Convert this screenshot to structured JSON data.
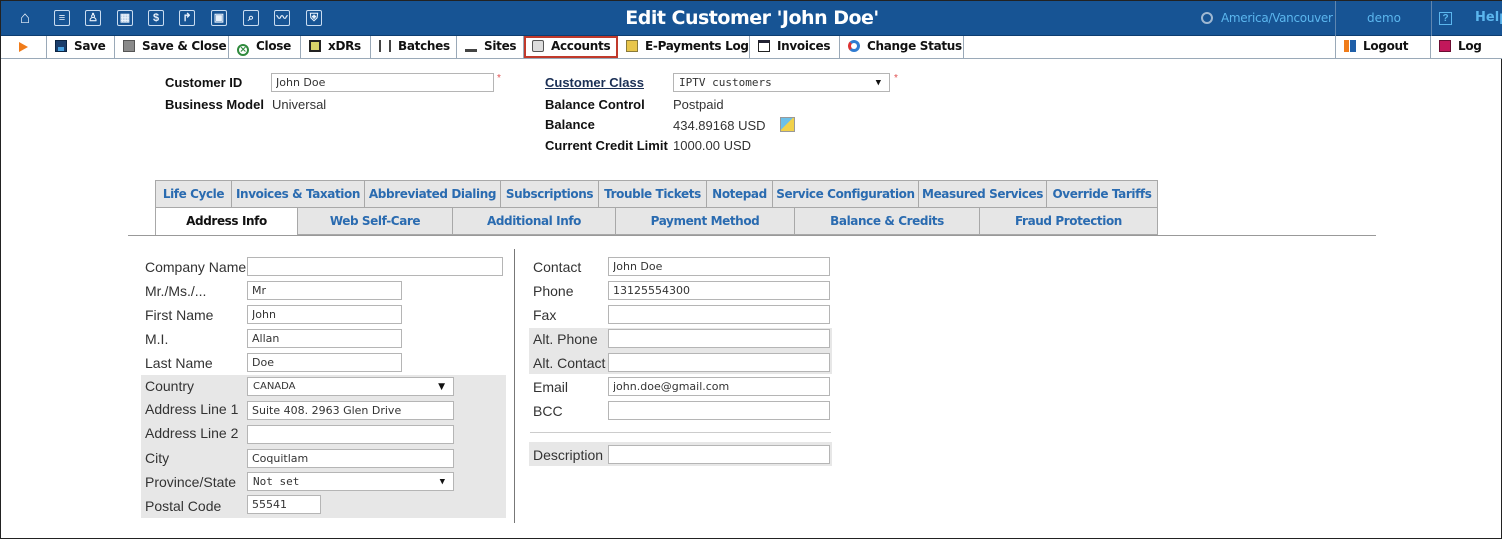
{
  "topbar": {
    "nav_icons": [
      "home-icon",
      "list-icon",
      "person-icon",
      "modules-icon",
      "dollar-icon",
      "routing-icon",
      "network-icon",
      "search-icon",
      "chart-icon",
      "shield-icon"
    ],
    "nav_glyphs": [
      "⌂",
      "≡",
      "♙",
      "▦",
      "$",
      "↱",
      "▣",
      "⌕",
      "〰",
      "⛨"
    ],
    "title": "Edit Customer 'John Doe'",
    "timezone": "America/Vancouver",
    "user": "demo",
    "help_label": "Help",
    "help_glyph": "?"
  },
  "toolbar": {
    "buttons": [
      {
        "label": "Save",
        "icon": "save-icon"
      },
      {
        "label": "Save & Close",
        "icon": "save-close-icon"
      },
      {
        "label": "Close",
        "icon": "close-icon"
      },
      {
        "label": "xDRs",
        "icon": "xdrs-icon"
      },
      {
        "label": "Batches",
        "icon": "batches-icon"
      },
      {
        "label": "Sites",
        "icon": "sites-icon"
      },
      {
        "label": "Accounts",
        "icon": "accounts-icon"
      },
      {
        "label": "E-Payments Log",
        "icon": "epayments-icon"
      },
      {
        "label": "Invoices",
        "icon": "invoices-icon"
      },
      {
        "label": "Change Status",
        "icon": "change-status-icon"
      }
    ],
    "active": "Accounts",
    "logout_label": "Logout",
    "log_label": "Log"
  },
  "header": {
    "customer_id_label": "Customer ID",
    "customer_id_value": "John Doe",
    "business_model_label": "Business Model",
    "business_model_value": "Universal",
    "customer_class_label": "Customer Class",
    "customer_class_value": "IPTV customers",
    "balance_control_label": "Balance Control",
    "balance_control_value": "Postpaid",
    "balance_label": "Balance",
    "balance_value": "434.89168 USD",
    "credit_limit_label": "Current Credit Limit",
    "credit_limit_value": "1000.00 USD",
    "required_mark": "*"
  },
  "tabs": {
    "row1": [
      "Life Cycle",
      "Invoices & Taxation",
      "Abbreviated Dialing",
      "Subscriptions",
      "Trouble Tickets",
      "Notepad",
      "Service Configuration",
      "Measured Services",
      "Override Tariffs"
    ],
    "row2": [
      "Address Info",
      "Web Self-Care",
      "Additional Info",
      "Payment Method",
      "Balance & Credits",
      "Fraud Protection"
    ],
    "active": "Address Info"
  },
  "address": {
    "left": [
      {
        "label": "Company Name",
        "value": ""
      },
      {
        "label": "Mr./Ms./...",
        "value": "Mr"
      },
      {
        "label": "First Name",
        "value": "John"
      },
      {
        "label": "M.I.",
        "value": "Allan"
      },
      {
        "label": "Last Name",
        "value": "Doe"
      },
      {
        "label": "Country",
        "value": "CANADA"
      },
      {
        "label": "Address Line 1",
        "value": "Suite 408. 2963 Glen Drive"
      },
      {
        "label": "Address Line 2",
        "value": ""
      },
      {
        "label": "City",
        "value": "Coquitlam"
      },
      {
        "label": "Province/State",
        "value": "Not set"
      },
      {
        "label": "Postal Code",
        "value": "55541"
      }
    ],
    "right": [
      {
        "label": "Contact",
        "value": "John Doe"
      },
      {
        "label": "Phone",
        "value": "13125554300"
      },
      {
        "label": "Fax",
        "value": ""
      },
      {
        "label": "Alt. Phone",
        "value": ""
      },
      {
        "label": "Alt. Contact",
        "value": ""
      },
      {
        "label": "Email",
        "value": "john.doe@gmail.com"
      },
      {
        "label": "BCC",
        "value": ""
      },
      {
        "label": "Description",
        "value": ""
      }
    ]
  }
}
